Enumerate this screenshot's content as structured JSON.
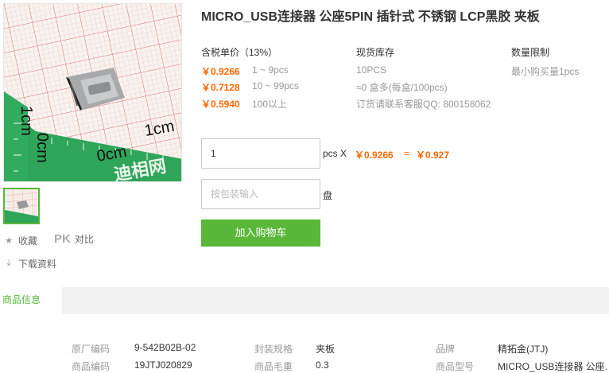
{
  "title": "MICRO_USB连接器 公座5PIN 插针式 不锈钢 LCP黑胶 夹板",
  "pricing": {
    "heading": "含税单价（13%）",
    "tiers": [
      {
        "price": "￥0.9266",
        "range": "1 ~ 9pcs"
      },
      {
        "price": "￥0.7128",
        "range": "10 ~ 99pcs"
      },
      {
        "price": "￥0.5940",
        "range": "100以上"
      }
    ]
  },
  "stock": {
    "heading": "现货库存",
    "qty": "10PCS",
    "pack": "≈0 盒多(每盒/100pcs)",
    "contact": "订货请联系客服QQ: 800158062"
  },
  "limit": {
    "heading": "数量限制",
    "text": "最小购买量1pcs"
  },
  "order": {
    "qty_value": "1",
    "pcs_x": "pcs X",
    "unit_price": "￥0.9266",
    "equals": "=",
    "total": "￥0.927",
    "pack_placeholder": "按包装输入",
    "pack_unit": "盘",
    "cart_label": "加入购物车"
  },
  "side": {
    "favorite": "收藏",
    "pk": "PK",
    "compare": "对比",
    "download": "下载资料"
  },
  "tabs": {
    "active": "商品信息"
  },
  "specs": [
    {
      "key": "原厂编码",
      "value": "9-542B02B-02"
    },
    {
      "key": "封装规格",
      "value": "夹板"
    },
    {
      "key": "品牌",
      "value": "精拓金(JTJ)"
    },
    {
      "key": "商品编码",
      "value": "19JTJ020829"
    },
    {
      "key": "商品毛重",
      "value": "0.3"
    },
    {
      "key": "商品型号",
      "value": "MICRO_USB连接器 公座."
    }
  ],
  "image_marks": {
    "label_1cm_left": "1cm",
    "label_0cm_left": "0cm",
    "label_0cm_bottom": "0cm",
    "label_1cm_bottom": "1cm",
    "board_text": "迪相网"
  },
  "colors": {
    "accent_green": "#5ab73a",
    "price_orange": "#ff6600"
  }
}
